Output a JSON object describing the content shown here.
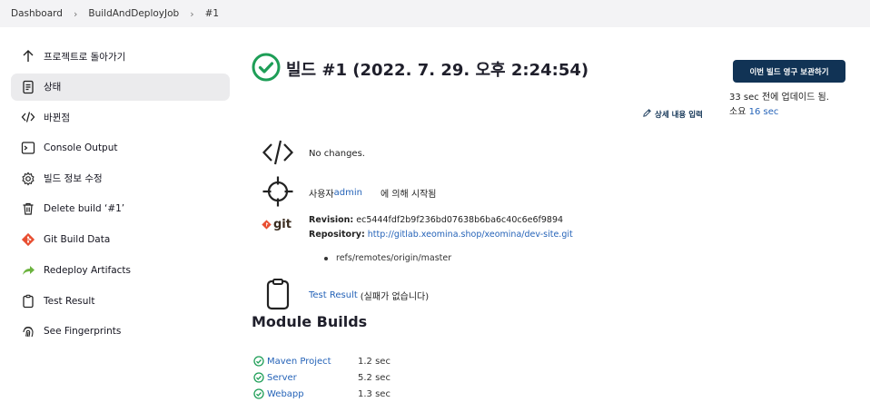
{
  "breadcrumbs": [
    "Dashboard",
    "BuildAndDeployJob",
    "#1"
  ],
  "sidebar": {
    "items": [
      {
        "label": "프로젝트로 돌아가기",
        "icon": "arrow-up-icon"
      },
      {
        "label": "상태",
        "icon": "document-icon"
      },
      {
        "label": "바뀐점",
        "icon": "code-icon"
      },
      {
        "label": "Console Output",
        "icon": "terminal-icon"
      },
      {
        "label": "빌드 정보 수정",
        "icon": "gear-icon"
      },
      {
        "label": "Delete build ‘#1’",
        "icon": "trash-icon"
      },
      {
        "label": "Git Build Data",
        "icon": "git-icon"
      },
      {
        "label": "Redeploy Artifacts",
        "icon": "redeploy-icon"
      },
      {
        "label": "Test Result",
        "icon": "clipboard-icon"
      },
      {
        "label": "See Fingerprints",
        "icon": "fingerprint-icon"
      }
    ]
  },
  "build": {
    "title": "빌드 #1 (2022. 7. 29. 오후 2:24:54)",
    "keep_button": "이번 빌드 영구 보관하기",
    "updated": "33 sec 전에 업데이드 됨.",
    "duration_prefix": "소요 ",
    "duration": "16 sec",
    "edit_description": "상세 내용 입력"
  },
  "changes": {
    "text": "No changes."
  },
  "started": {
    "prefix": "사용자 ",
    "user": "admin",
    "suffix": "에 의해 시작됨"
  },
  "git": {
    "label": "git",
    "revision_label": "Revision:",
    "revision": "ec5444fdf2b9f236bd07638b6ba6c40c6e6f9894",
    "repository_label": "Repository:",
    "repository": "http://gitlab.xeomina.shop/xeomina/dev-site.git",
    "branch": "refs/remotes/origin/master"
  },
  "test_result": {
    "link": "Test Result",
    "note": "(실패가 없습니다)"
  },
  "modules": {
    "heading": "Module Builds",
    "items": [
      {
        "name": "Maven Project",
        "time": "1.2 sec"
      },
      {
        "name": "Server",
        "time": "5.2 sec"
      },
      {
        "name": "Webapp",
        "time": "1.3 sec"
      }
    ]
  },
  "colors": {
    "success": "#1e9e57",
    "primary_button": "#113355",
    "link": "#2563b8"
  }
}
